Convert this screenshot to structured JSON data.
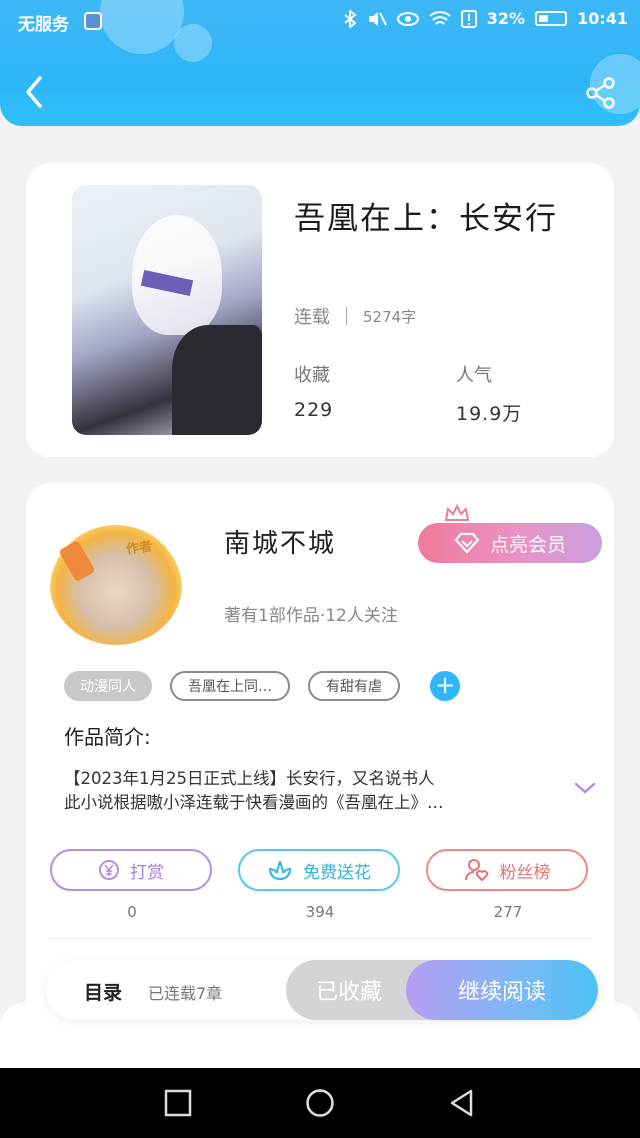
{
  "status_bar": {
    "carrier": "无服务",
    "battery": "32%",
    "time": "10:41"
  },
  "header": {
    "back_icon": "chevron-left-icon",
    "share_icon": "share-icon"
  },
  "book": {
    "title": "吾凰在上：长安行",
    "status": "连载",
    "word_count": "5274字",
    "collect_label": "收藏",
    "collect_value": "229",
    "popularity_label": "人气",
    "popularity_value": "19.9万"
  },
  "author": {
    "badge": "作者",
    "name": "南城不城",
    "meta": "著有1部作品·12人关注",
    "vip_button": "点亮会员"
  },
  "tags": [
    "动漫同人",
    "吾凰在上同…",
    "有甜有虐"
  ],
  "intro": {
    "label": "作品简介:",
    "line1": "【2023年1月25日正式上线】长安行，又名说书人",
    "line2": "此小说根据嗷小泽连载于快看漫画的《吾凰在上》…"
  },
  "actions": {
    "reward_label": "打赏",
    "reward_count": "0",
    "flower_label": "免费送花",
    "flower_count": "394",
    "fans_label": "粉丝榜",
    "fans_count": "277"
  },
  "read_bar": {
    "toc_label": "目录",
    "toc_count": "已连载7章",
    "collected_label": "已收藏",
    "continue_label": "继续阅读"
  },
  "colors": {
    "header": "#2eb6f8",
    "accent_blue": "#2eb6f8",
    "vip_pink": "#f07a9a"
  }
}
